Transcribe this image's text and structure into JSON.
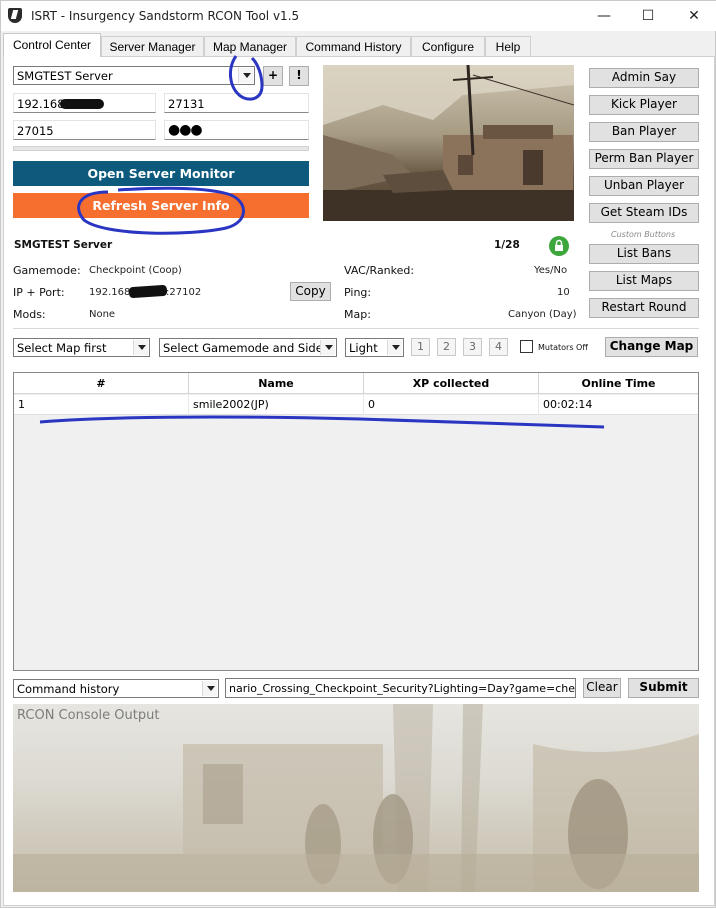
{
  "window": {
    "title": "ISRT - Insurgency Sandstorm RCON Tool v1.5",
    "icon": "app-shield-icon",
    "controls": [
      "minimize-icon",
      "maximize-icon",
      "close-icon"
    ]
  },
  "tabs": [
    {
      "label": "Control Center",
      "active": true
    },
    {
      "label": "Server Manager",
      "active": false
    },
    {
      "label": "Map Manager",
      "active": false
    },
    {
      "label": "Command History",
      "active": false
    },
    {
      "label": "Configure",
      "active": false
    },
    {
      "label": "Help",
      "active": false
    }
  ],
  "connection": {
    "server_select": "SMGTEST Server",
    "add_label": "+",
    "warn_label": "!",
    "ip": "192.168.",
    "game_port": "27131",
    "rcon_port": "27015",
    "password": "●●●"
  },
  "actions": {
    "open_monitor": "Open Server Monitor",
    "refresh_info": "Refresh Server Info"
  },
  "side_buttons": {
    "admin_say": "Admin Say",
    "kick": "Kick Player",
    "ban": "Ban Player",
    "perm_ban": "Perm Ban Player",
    "unban": "Unban Player",
    "get_steam_ids": "Get Steam IDs",
    "custom_caption": "Custom Buttons",
    "list_bans": "List Bans",
    "list_maps": "List Maps",
    "restart_round": "Restart Round"
  },
  "server_info": {
    "name": "SMGTEST Server",
    "players": "1/28",
    "gamemode_label": "Gamemode:",
    "gamemode": "Checkpoint (Coop)",
    "ipport_label": "IP + Port:",
    "ip_start": "192.168.",
    "ip_end": ":27102",
    "copy_label": "Copy",
    "mods_label": "Mods:",
    "mods": "None",
    "vac_label": "VAC/Ranked:",
    "vac": "Yes/No",
    "ping_label": "Ping:",
    "ping": "10",
    "map_label": "Map:",
    "map": "Canyon (Day)",
    "lock_color": "#3da63d"
  },
  "map_controls": {
    "map_select": "Select Map first",
    "mode_select": "Select Gamemode and Side",
    "light_select": "Light",
    "slots": [
      "1",
      "2",
      "3",
      "4"
    ],
    "mutators_label": "Mutators Off",
    "change_map": "Change Map"
  },
  "players_table": {
    "headers": [
      "#",
      "Name",
      "XP collected",
      "Online Time"
    ],
    "rows": [
      {
        "num": "1",
        "name": "smile2002(JP)",
        "xp": "0",
        "time": "00:02:14"
      }
    ]
  },
  "command": {
    "history_select": "Command history",
    "input_value": "nario_Crossing_Checkpoint_Security?Lighting=Day?game=checkpoint",
    "clear_label": "Clear",
    "submit_label": "Submit"
  },
  "console": {
    "placeholder": "RCON Console Output"
  },
  "colors": {
    "open_monitor_bg": "#0d5a7d",
    "refresh_bg": "#f66f2f",
    "annotation": "#2a35c2"
  }
}
